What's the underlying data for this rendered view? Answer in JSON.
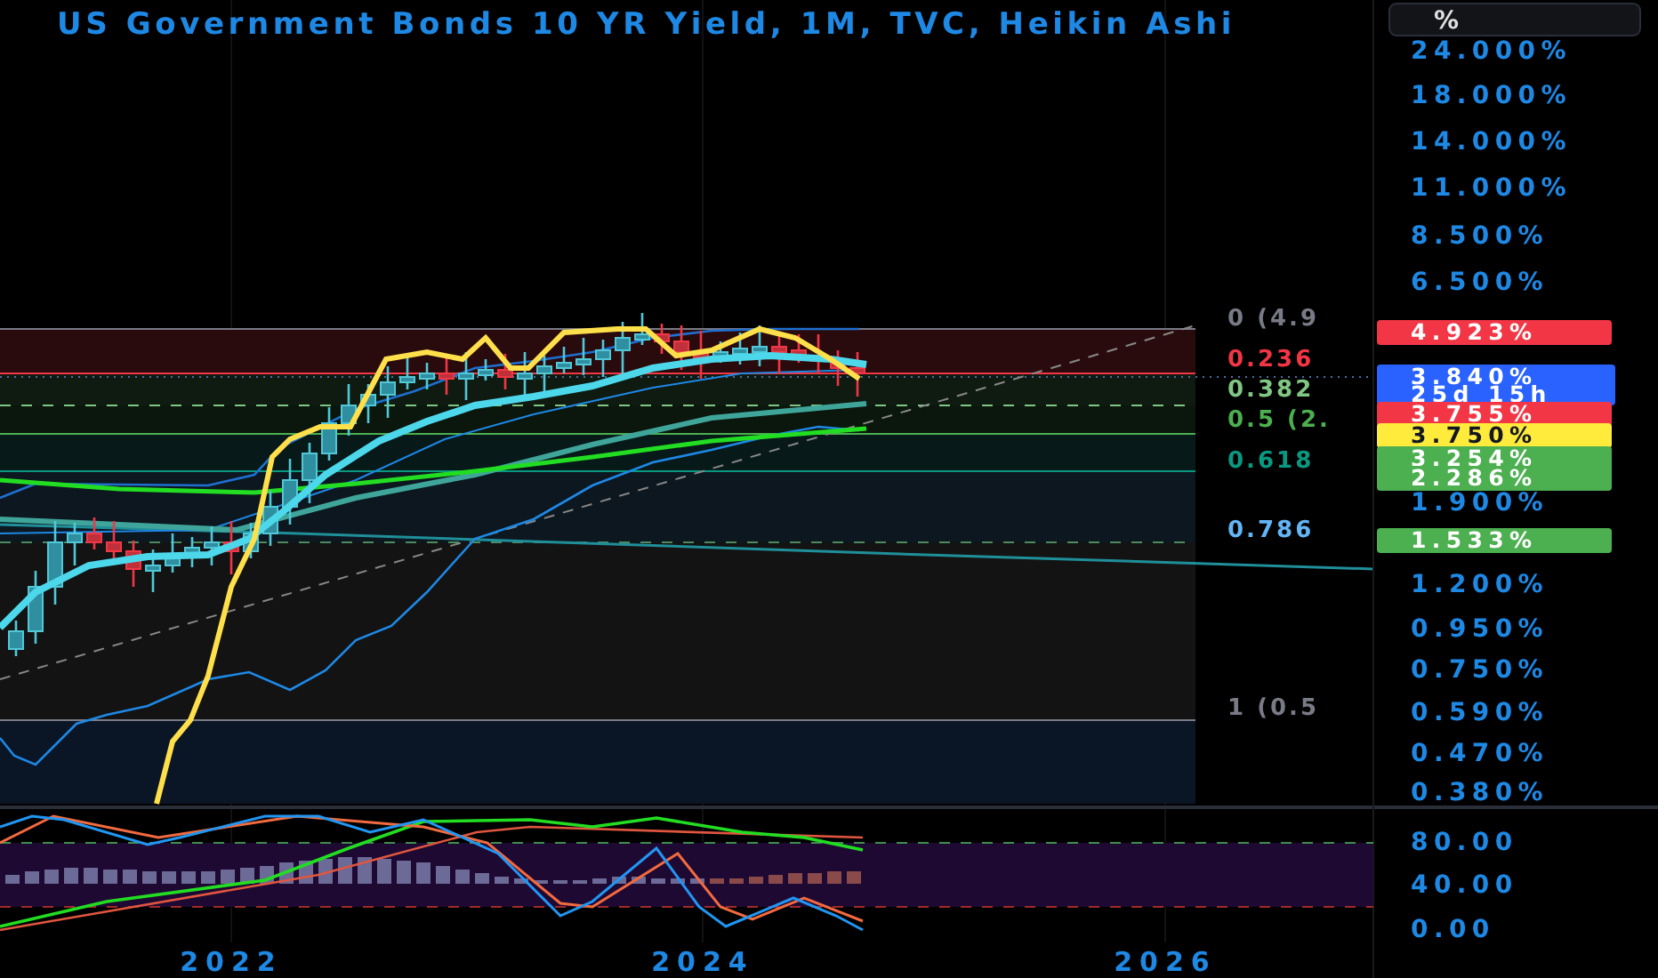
{
  "title": "US Government Bonds 10 YR Yield, 1M, TVC, Heikin Ashi",
  "scale_button": {
    "label": "%"
  },
  "price_axis": [
    "24.000%",
    "18.000%",
    "14.000%",
    "11.000%",
    "8.500%",
    "6.500%",
    "1.900%",
    "1.200%",
    "0.950%",
    "0.750%",
    "0.590%",
    "0.470%",
    "0.380%"
  ],
  "fib_levels": [
    {
      "label": "0 (4.9",
      "color": "#787b86"
    },
    {
      "label": "0.236",
      "color": "#f23645"
    },
    {
      "label": "0.382",
      "color": "#81c784"
    },
    {
      "label": "0.5 (2.",
      "color": "#4caf50"
    },
    {
      "label": "0.618",
      "color": "#089981"
    },
    {
      "label": "0.786",
      "color": "#64b5f6"
    },
    {
      "label": "1 (0.5",
      "color": "#787b86"
    }
  ],
  "price_tags": [
    {
      "text": "4.923%",
      "color": "#f23645"
    },
    {
      "text": "3.840%",
      "countdown": "25d 15h",
      "color": "#2962ff"
    },
    {
      "text": "3.755%",
      "color": "#f23645"
    },
    {
      "text": "3.750%",
      "color": "#ffeb3b"
    },
    {
      "text": "3.254%",
      "color": "#4caf50"
    },
    {
      "text": "2.286%",
      "color": "#4caf50"
    },
    {
      "text": "1.533%",
      "color": "#4caf50"
    }
  ],
  "oscillator_axis": [
    "80.00",
    "40.00",
    "0.00"
  ],
  "time_axis": [
    "2022",
    "2024",
    "2026"
  ]
}
